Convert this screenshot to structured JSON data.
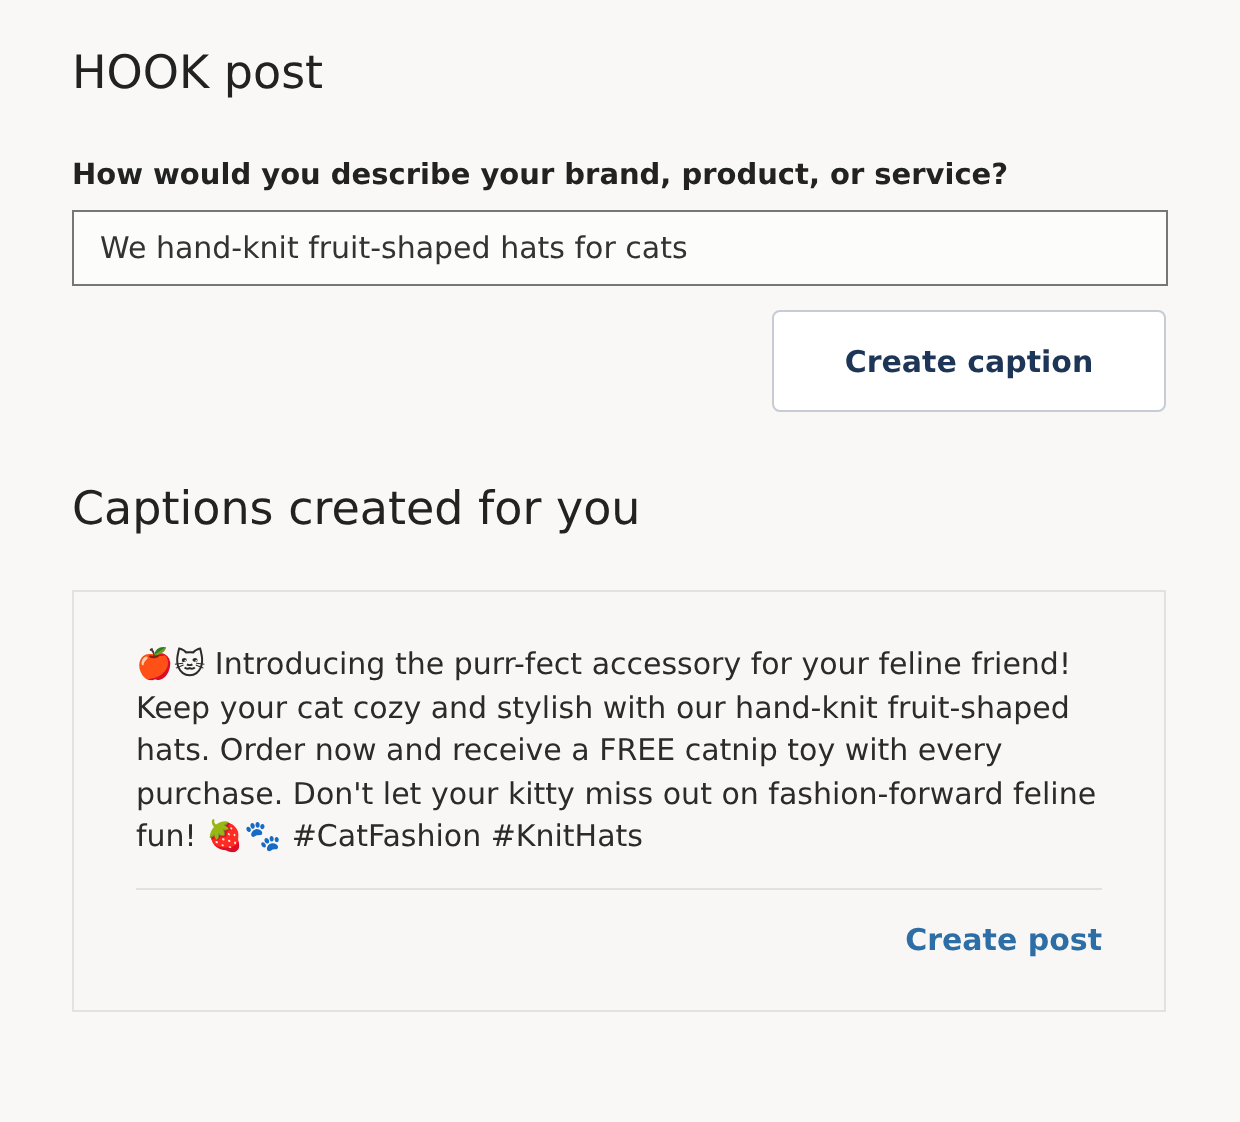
{
  "title": "HOOK post",
  "field": {
    "label": "How would you describe your brand, product, or service?",
    "value": "We hand-knit fruit-shaped hats for cats"
  },
  "create_button": "Create caption",
  "captions_heading": "Captions created for you",
  "captions": [
    {
      "text": "🍎🐱 Introducing the purr-fect accessory for your feline friend! Keep your cat cozy and stylish with our hand-knit fruit-shaped hats. Order now and receive a FREE catnip toy with every purchase. Don't let your kitty miss out on fashion-forward feline fun! 🍓🐾 #CatFashion #KnitHats",
      "action": "Create post"
    }
  ]
}
